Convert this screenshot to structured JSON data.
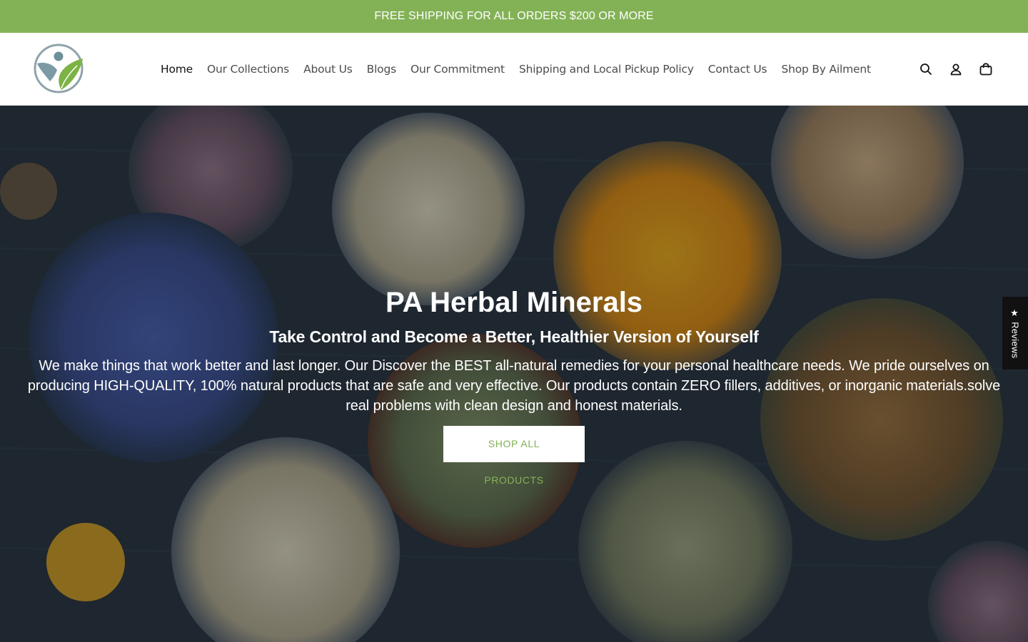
{
  "announcement": {
    "text": "FREE SHIPPING FOR ALL ORDERS $200 OR MORE"
  },
  "header": {
    "logo_icon": "person-leaf-logo",
    "nav": [
      {
        "label": "Home",
        "active": true
      },
      {
        "label": "Our Collections"
      },
      {
        "label": "About Us"
      },
      {
        "label": "Blogs"
      },
      {
        "label": "Our Commitment"
      },
      {
        "label": "Shipping and Local Pickup Policy"
      },
      {
        "label": "Contact Us"
      },
      {
        "label": "Shop By Ailment"
      }
    ],
    "icons": [
      "search-icon",
      "account-icon",
      "cart-icon"
    ]
  },
  "hero": {
    "title": "PA Herbal Minerals",
    "subtitle": "Take Control and Become a Better, Healthier Version of Yourself",
    "text": "We make things that work better and last longer. Our Discover the BEST all-natural remedies for your personal healthcare needs. We pride ourselves on producing HIGH-QUALITY, 100% natural products that are safe and very effective. Our products contain ZERO fillers, additives, or inorganic materials.solve real problems with clean design and honest materials.",
    "button_label": "SHOP ALL PRODUCTS"
  },
  "reviews_tab": {
    "label": "★ Reviews"
  },
  "colors": {
    "accent": "#83b256",
    "text": "#121212",
    "nav_text": "#4d4d4d"
  }
}
